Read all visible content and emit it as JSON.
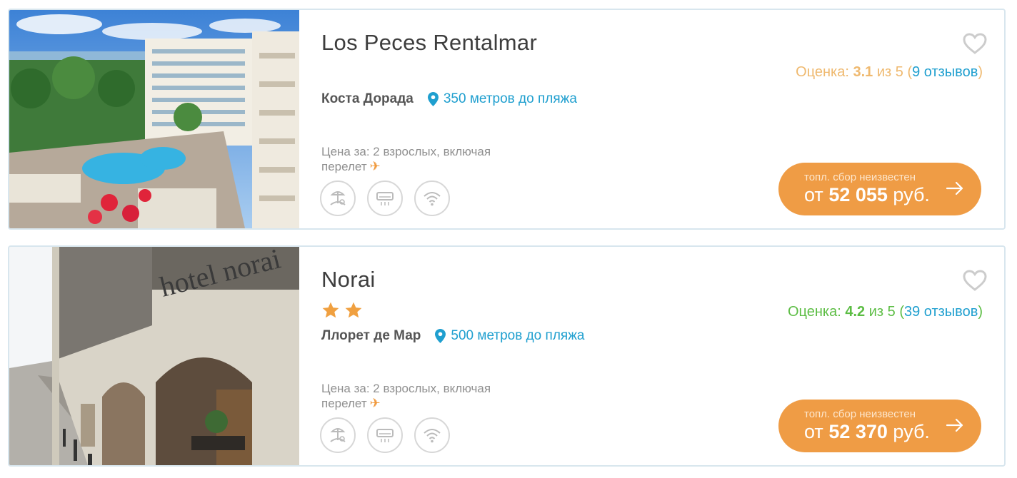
{
  "hotels": [
    {
      "name": "Los Peces Rentalmar",
      "stars": 0,
      "region": "Коста Дорада",
      "distance": "350 метров до пляжа",
      "rating_label": "Оценка:",
      "rating_value": "3.1",
      "rating_of": "из 5",
      "reviews_open": "(",
      "reviews": "9 отзывов",
      "reviews_close": ")",
      "price_note_line1": "Цена за: 2 взрослых, включая",
      "price_note_line2": "перелет",
      "fee_note": "топл. сбор неизвестен",
      "price_prefix": "от",
      "price_amount": "52 055",
      "price_currency": "руб.",
      "amenities": [
        "beach-icon",
        "air-conditioner-icon",
        "wifi-icon"
      ],
      "rating_color": "#efb96f"
    },
    {
      "name": "Norai",
      "stars": 2,
      "region": "Ллорет де Мар",
      "distance": "500 метров до пляжа",
      "rating_label": "Оценка:",
      "rating_value": "4.2",
      "rating_of": "из 5",
      "reviews_open": "(",
      "reviews": "39 отзывов",
      "reviews_close": ")",
      "price_note_line1": "Цена за: 2 взрослых, включая",
      "price_note_line2": "перелет",
      "fee_note": "топл. сбор неизвестен",
      "price_prefix": "от",
      "price_amount": "52 370",
      "price_currency": "руб.",
      "amenities": [
        "beach-icon",
        "air-conditioner-icon",
        "wifi-icon"
      ],
      "rating_color": "#5cbd44"
    }
  ],
  "colors": {
    "accent_orange": "#ef9c45",
    "link_blue": "#1f9fcf",
    "star_orange": "#f0a040",
    "card_border": "#d8e6ee"
  }
}
